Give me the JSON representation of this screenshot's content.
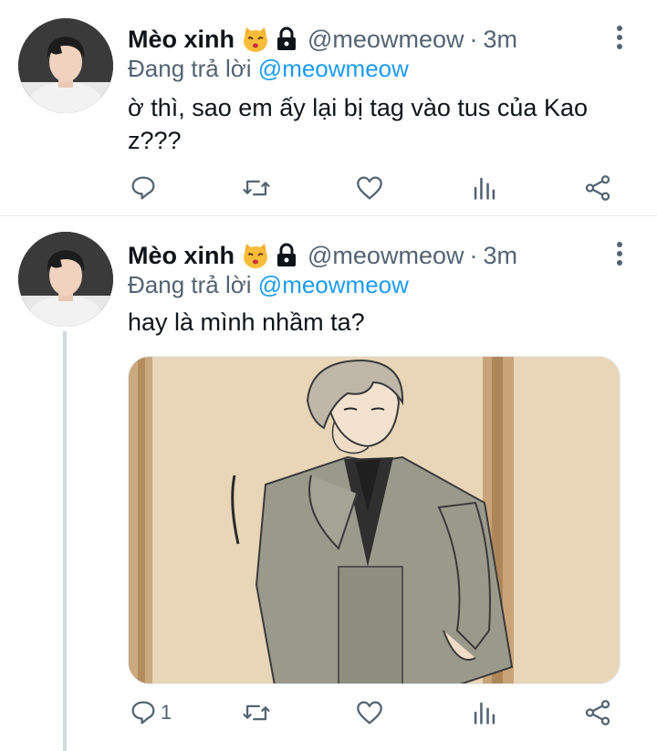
{
  "colors": {
    "text": "#0f1419",
    "secondary": "#536471",
    "accent": "#1d9bf0",
    "border": "#e6ecf0"
  },
  "tweets": [
    {
      "name": "Mèo xinh",
      "handle": "@meowmeow",
      "time": "3m",
      "separator": "·",
      "replying_prefix": "Đang trả lời",
      "replying_to": "@meowmeow",
      "text": "ờ thì, sao em ấy lại bị tag vào tus của Kao z???",
      "icons": [
        "kissing-cat-emoji",
        "lock-icon",
        "more-vertical-icon",
        "reply-icon",
        "retweet-icon",
        "like-icon",
        "views-icon",
        "share-icon"
      ],
      "reply_count": ""
    },
    {
      "name": "Mèo xinh",
      "handle": "@meowmeow",
      "time": "3m",
      "separator": "·",
      "replying_prefix": "Đang trả lời",
      "replying_to": "@meowmeow",
      "text": "hay là mình nhầm ta?",
      "has_media": true,
      "media_description": "manga illustration",
      "reply_count": "1"
    }
  ]
}
